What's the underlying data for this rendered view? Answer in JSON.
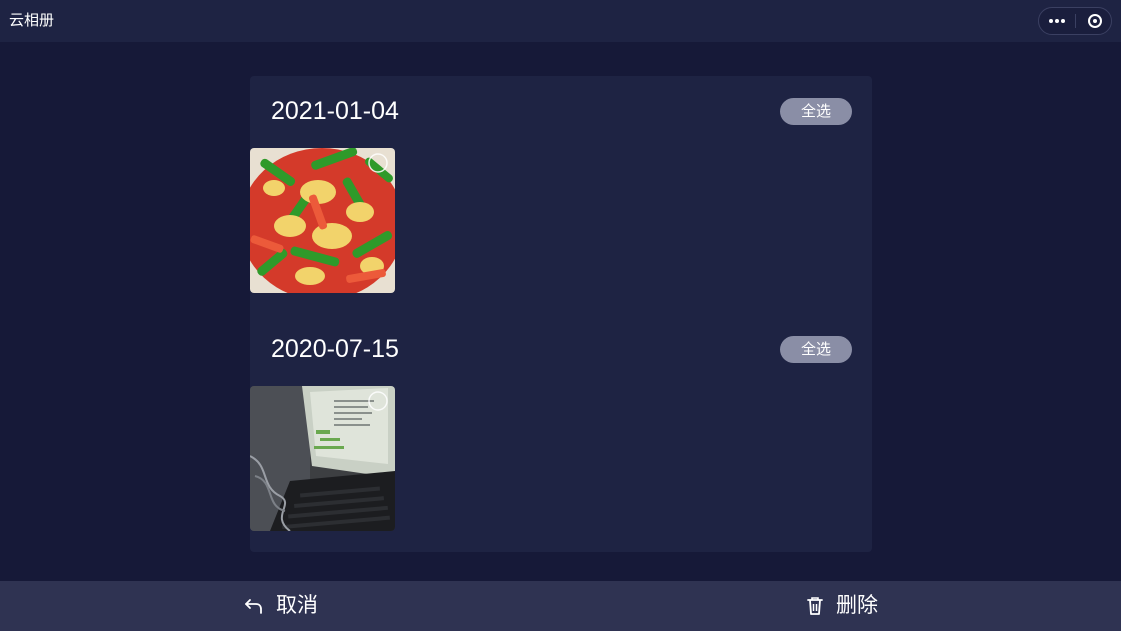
{
  "app": {
    "title": "云相册",
    "capsule": {
      "more_icon": "more-dots-icon",
      "close_icon": "target-circle-icon"
    }
  },
  "groups": [
    {
      "date": "2021-01-04",
      "select_all_label": "全选",
      "photos": [
        {
          "subject": "stir-fried peppers and eggs",
          "selected": false
        }
      ]
    },
    {
      "date": "2020-07-15",
      "select_all_label": "全选",
      "photos": [
        {
          "subject": "laptop screen on desk",
          "selected": false
        }
      ]
    }
  ],
  "bottom_bar": {
    "cancel_label": "取消",
    "cancel_icon": "undo-arrow-icon",
    "delete_label": "删除",
    "delete_icon": "trash-icon"
  },
  "colors": {
    "background": "#161938",
    "panel": "#1e2343",
    "bottom_bar": "#2f3352",
    "select_all_button": "#8a8ea6",
    "text": "#ffffff"
  }
}
